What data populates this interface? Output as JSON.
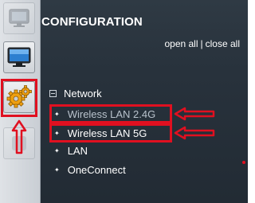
{
  "panel": {
    "title": "CONFIGURATION",
    "open_all": "open all",
    "separator": "|",
    "close_all": "close all"
  },
  "tree": {
    "root_label": "Network",
    "items": [
      {
        "label": "Wireless LAN 2.4G"
      },
      {
        "label": "Wireless LAN 5G"
      },
      {
        "label": "LAN"
      },
      {
        "label": "OneConnect"
      }
    ]
  },
  "rail": {
    "buttons": [
      "monitor-icon",
      "display-icon",
      "gears-icon",
      "hidden-icon"
    ]
  },
  "colors": {
    "panel_bg": "#28323c",
    "rail_bg": "#c9ced4",
    "highlight": "#e01020",
    "gear": "#f0a010"
  }
}
